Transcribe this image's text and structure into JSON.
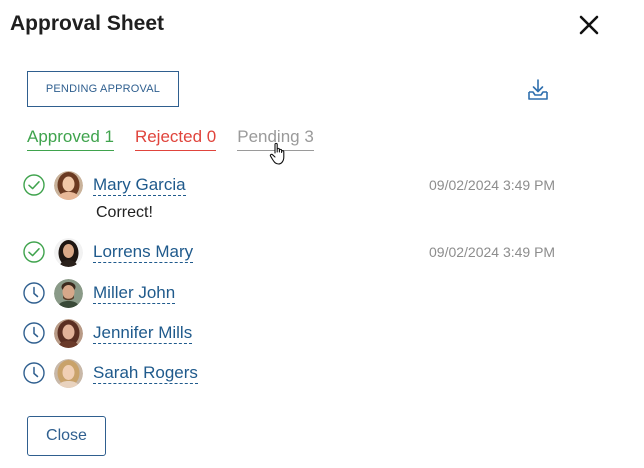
{
  "dialog": {
    "title": "Approval Sheet"
  },
  "status_button": {
    "label": "PENDING APPROVAL"
  },
  "tabs": [
    {
      "label": "Approved 1",
      "color": "#3fa34d"
    },
    {
      "label": "Rejected 0",
      "color": "#e0443c"
    },
    {
      "label": "Pending 3",
      "color": "#9a9a9a"
    }
  ],
  "approvers": [
    {
      "name": "Mary Garcia",
      "status_icon": "check-circle-icon",
      "date": "09/02/2024 3:49 PM",
      "comment": "Correct!"
    },
    {
      "name": "Lorrens Mary",
      "status_icon": "check-circle-icon",
      "date": "09/02/2024 3:49 PM"
    },
    {
      "name": "Miller John",
      "status_icon": "clock-icon"
    },
    {
      "name": "Jennifer Mills",
      "status_icon": "clock-icon"
    },
    {
      "name": "Sarah Rogers",
      "status_icon": "clock-icon"
    }
  ],
  "footer": {
    "close_label": "Close"
  },
  "colors": {
    "link": "#1f5a8c",
    "approved": "#3fa34d",
    "pending_icon": "#2f5f8f"
  }
}
